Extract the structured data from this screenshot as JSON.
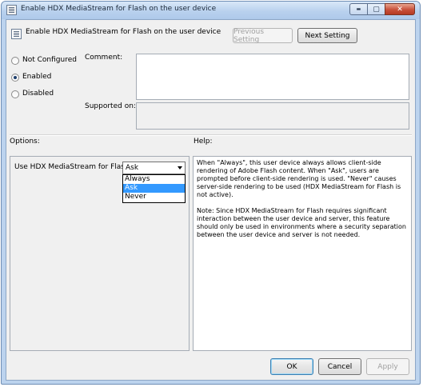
{
  "window": {
    "title": "Enable HDX MediaStream for Flash on the user device",
    "caption_buttons": {
      "minimize": "▬",
      "maximize": "▢",
      "close": "✕"
    }
  },
  "header": {
    "policy_name": "Enable HDX MediaStream for Flash on the user device",
    "prev_label": "Previous Setting",
    "next_label": "Next Setting"
  },
  "state": {
    "options": [
      {
        "label": "Not Configured",
        "selected": false
      },
      {
        "label": "Enabled",
        "selected": true
      },
      {
        "label": "Disabled",
        "selected": false
      }
    ]
  },
  "comment": {
    "label": "Comment:",
    "value": ""
  },
  "supported": {
    "label": "Supported on:",
    "value": ""
  },
  "options_panel": {
    "label": "Options:",
    "setting_label": "Use HDX MediaStream for Flash",
    "selected_value": "Ask",
    "dropdown_items": [
      "Always",
      "Ask",
      "Never"
    ],
    "highlighted_item": "Ask"
  },
  "help_panel": {
    "label": "Help:",
    "paragraphs": [
      "When \"Always\", this user device always allows client-side rendering of Adobe Flash content. When \"Ask\", users are prompted before client-side rendering is used. \"Never\" causes server-side rendering to be used (HDX MediaStream for Flash is not active).",
      "Note: Since HDX MediaStream for Flash requires significant interaction between the user device and server, this feature should only be used in environments where a security separation between the user device and server is not needed."
    ]
  },
  "footer": {
    "ok_label": "OK",
    "cancel_label": "Cancel",
    "apply_label": "Apply"
  },
  "colors": {
    "title_bar": "#b9d1ee",
    "client_bg": "#f0f0f0",
    "selection": "#3399ff",
    "close_button": "#c8513a"
  }
}
